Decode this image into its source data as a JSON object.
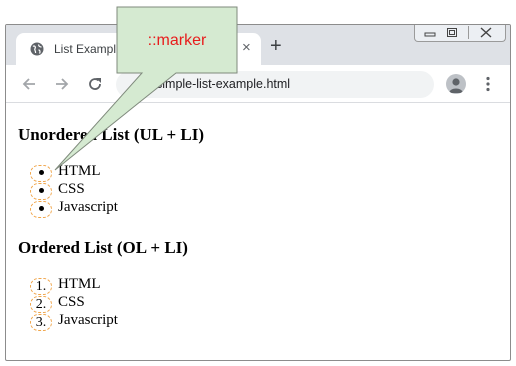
{
  "browser": {
    "tab_title": "List Example",
    "tab_close": "×",
    "new_tab": "+",
    "url": "simple-list-example.html"
  },
  "content": {
    "unordered_heading": "Unordered List (UL + LI)",
    "unordered_items": [
      "HTML",
      "CSS",
      "Javascript"
    ],
    "ordered_heading": "Ordered List (OL + LI)",
    "ordered_items": [
      "HTML",
      "CSS",
      "Javascript"
    ],
    "ordered_markers": [
      "1.",
      "2.",
      "3."
    ]
  },
  "annotation": {
    "label": "::marker"
  },
  "colors": {
    "callout_fill": "#d5ead1",
    "callout_label": "#e81c1c",
    "marker_outline": "#f0a64c"
  }
}
